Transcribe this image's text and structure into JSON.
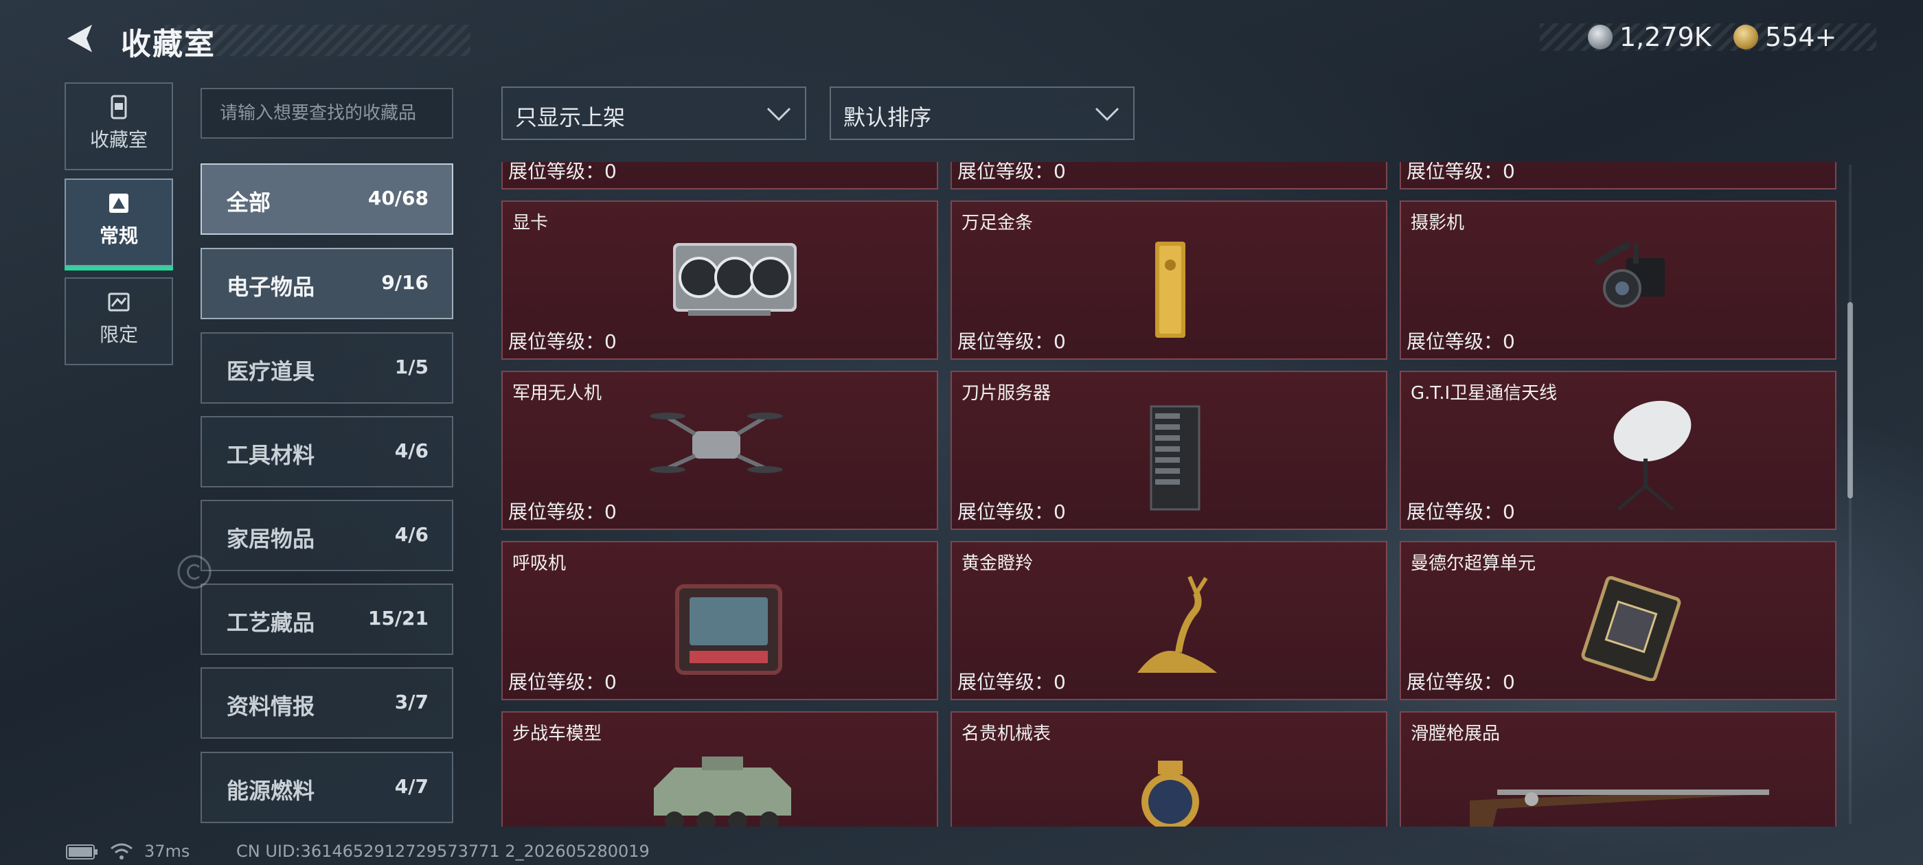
{
  "header": {
    "title": "收藏室"
  },
  "currency": {
    "silver": "1,279K",
    "gold": "554+"
  },
  "nav": [
    {
      "label": "收藏室",
      "icon": "collection-room-icon"
    },
    {
      "label": "常规",
      "icon": "regular-icon",
      "active": true
    },
    {
      "label": "限定",
      "icon": "limited-icon"
    }
  ],
  "search": {
    "placeholder": "请输入想要查找的收藏品",
    "value": ""
  },
  "filters": {
    "display": "只显示上架",
    "sort": "默认排序"
  },
  "categories": [
    {
      "name": "全部",
      "count": "40/68"
    },
    {
      "name": "电子物品",
      "count": "9/16"
    },
    {
      "name": "医疗道具",
      "count": "1/5"
    },
    {
      "name": "工具材料",
      "count": "4/6"
    },
    {
      "name": "家居物品",
      "count": "4/6"
    },
    {
      "name": "工艺藏品",
      "count": "15/21"
    },
    {
      "name": "资料情报",
      "count": "3/7"
    },
    {
      "name": "能源燃料",
      "count": "4/7"
    }
  ],
  "level_prefix": "展位等级：",
  "items": {
    "top_row": [
      {
        "level": "展位等级：0"
      },
      {
        "level": "展位等级：0"
      },
      {
        "level": "展位等级：0"
      }
    ],
    "rows": [
      [
        {
          "name": "显卡",
          "level": "展位等级：0",
          "icon": "graphics-card-icon"
        },
        {
          "name": "万足金条",
          "level": "展位等级：0",
          "icon": "gold-bar-icon"
        },
        {
          "name": "摄影机",
          "level": "展位等级：0",
          "icon": "video-camera-icon"
        }
      ],
      [
        {
          "name": "军用无人机",
          "level": "展位等级：0",
          "icon": "drone-icon"
        },
        {
          "name": "刀片服务器",
          "level": "展位等级：0",
          "icon": "server-icon"
        },
        {
          "name": "G.T.I卫星通信天线",
          "level": "展位等级：0",
          "icon": "satellite-dish-icon"
        }
      ],
      [
        {
          "name": "呼吸机",
          "level": "展位等级：0",
          "icon": "ventilator-icon"
        },
        {
          "name": "黄金瞪羚",
          "level": "展位等级：0",
          "icon": "golden-gazelle-icon"
        },
        {
          "name": "曼德尔超算单元",
          "level": "展位等级：0",
          "icon": "supercomputer-unit-icon"
        }
      ],
      [
        {
          "name": "步战车模型",
          "icon": "ifv-model-icon"
        },
        {
          "name": "名贵机械表",
          "icon": "luxury-watch-icon"
        },
        {
          "name": "滑膛枪展品",
          "icon": "musket-icon"
        }
      ]
    ]
  },
  "footer": {
    "ping": "37ms",
    "uid": "CN UID:3614652912729573771 2_202605280019"
  },
  "colors": {
    "accent": "#26d99a",
    "card_bg": "#4a1c25",
    "panel_border": "#96a5b4"
  }
}
